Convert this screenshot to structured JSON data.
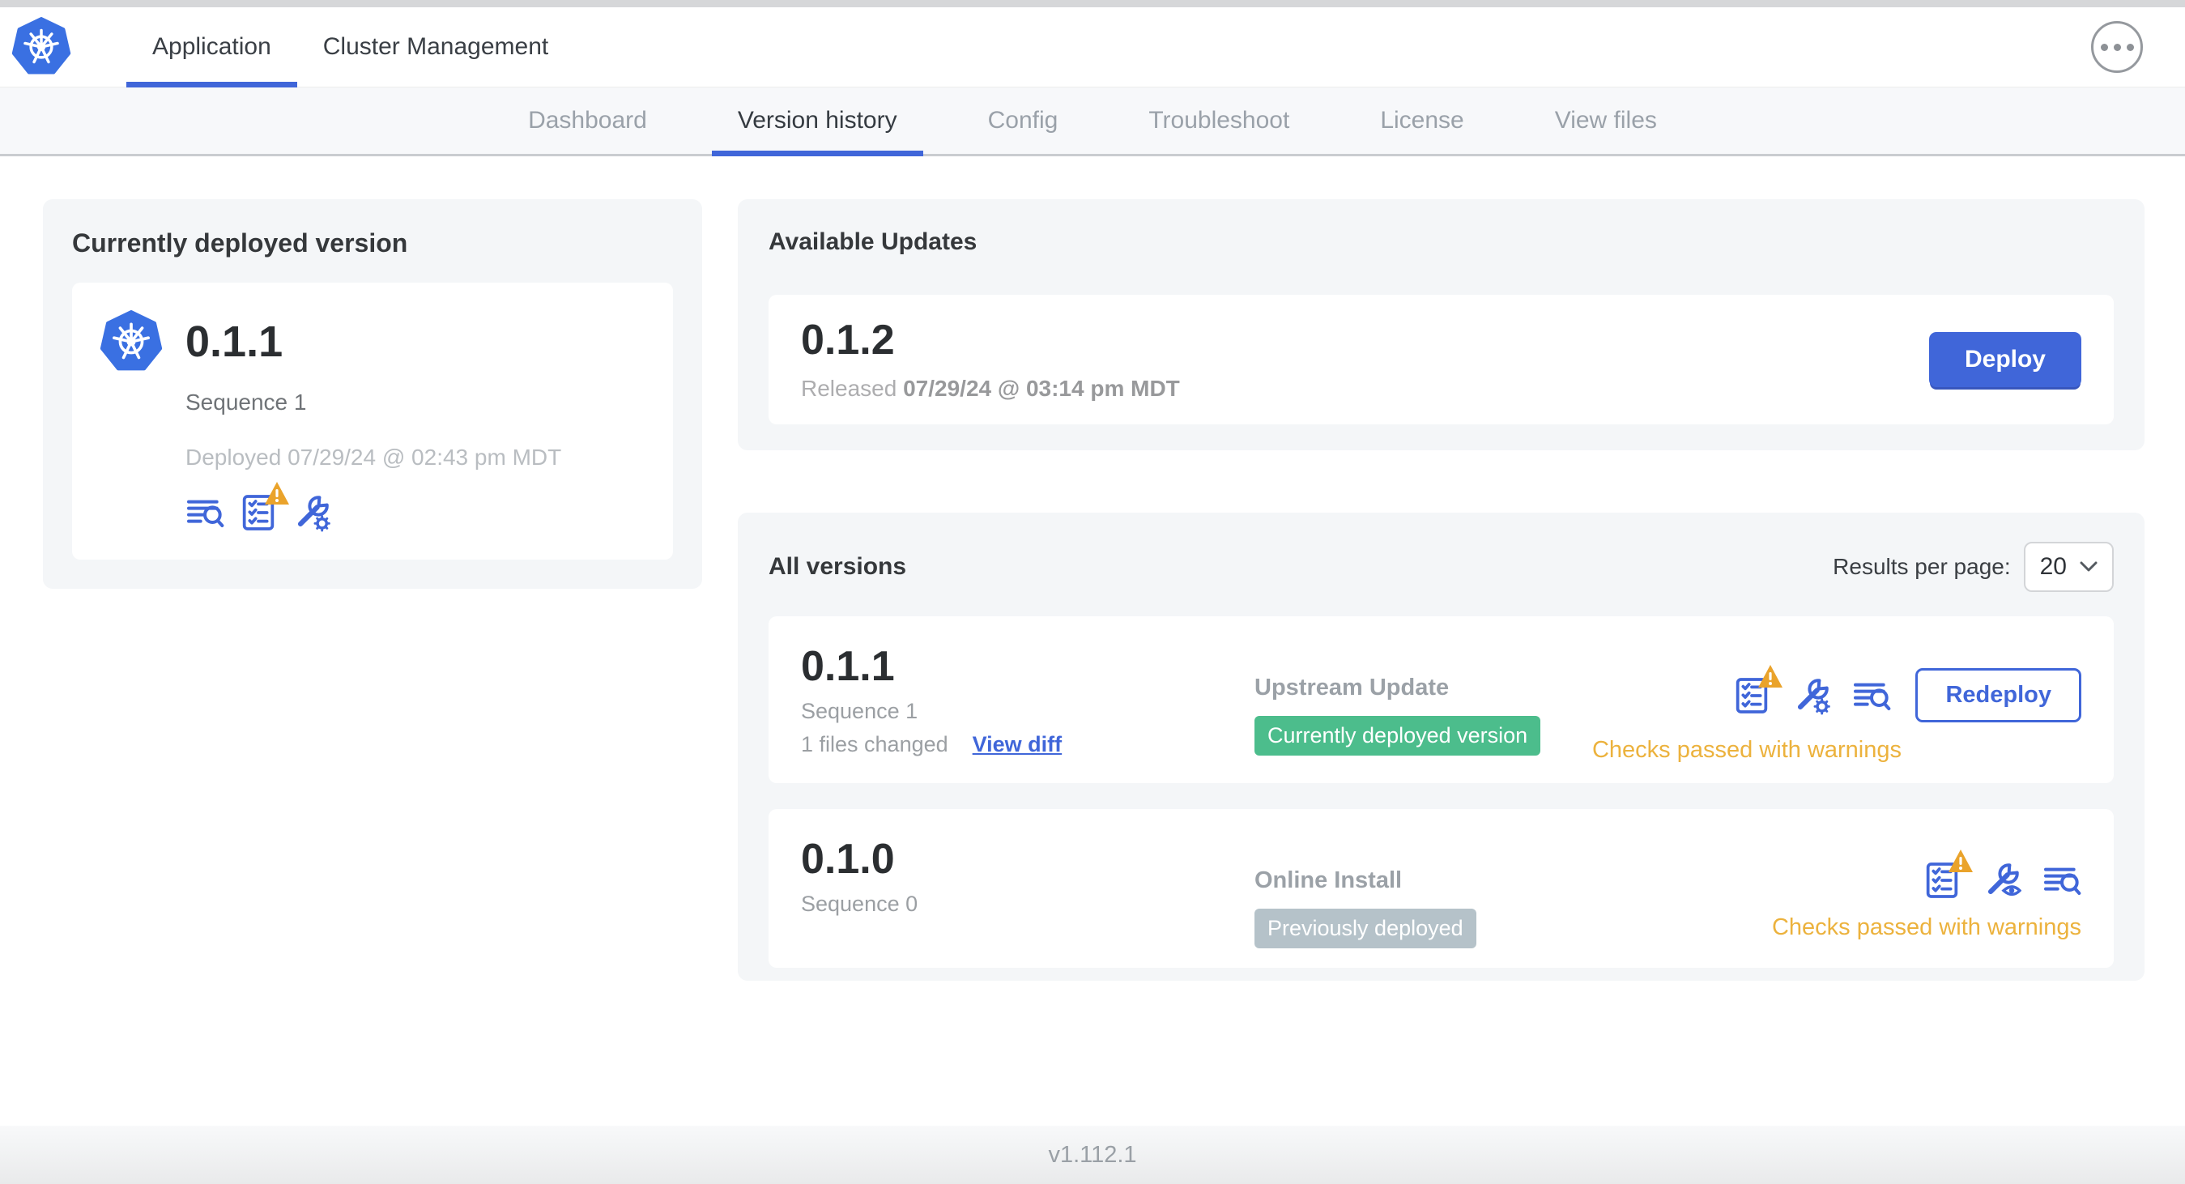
{
  "header": {
    "tabs": [
      {
        "label": "Application",
        "active": true
      },
      {
        "label": "Cluster Management",
        "active": false
      }
    ]
  },
  "subnav": {
    "items": [
      {
        "label": "Dashboard",
        "active": false
      },
      {
        "label": "Version history",
        "active": true
      },
      {
        "label": "Config",
        "active": false
      },
      {
        "label": "Troubleshoot",
        "active": false
      },
      {
        "label": "License",
        "active": false
      },
      {
        "label": "View files",
        "active": false
      }
    ]
  },
  "current_version_card": {
    "title": "Currently deployed version",
    "version": "0.1.1",
    "sequence": "Sequence 1",
    "deployed": "Deployed 07/29/24 @ 02:43 pm MDT",
    "icons": [
      "deploy-logs",
      "preflight-checks-warning",
      "config-tools"
    ]
  },
  "available_updates": {
    "title": "Available Updates",
    "version": "0.1.2",
    "released_label": "Released",
    "released_date": "07/29/24 @ 03:14 pm MDT",
    "deploy_label": "Deploy"
  },
  "all_versions": {
    "title": "All versions",
    "results_per_page_label": "Results per page:",
    "results_per_page_value": "20",
    "rows": [
      {
        "version": "0.1.1",
        "sequence": "Sequence 1",
        "files_changed": "1 files changed",
        "view_diff_label": "View diff",
        "source": "Upstream Update",
        "badge": "Currently deployed version",
        "badge_style": "green",
        "action_label": "Redeploy",
        "status": "Checks passed with warnings",
        "icons": [
          "preflight-checks-warning",
          "config-tools",
          "deploy-logs"
        ]
      },
      {
        "version": "0.1.0",
        "sequence": "Sequence 0",
        "source": "Online Install",
        "badge": "Previously deployed",
        "badge_style": "gray",
        "status": "Checks passed with warnings",
        "icons": [
          "preflight-checks-warning",
          "config-view",
          "deploy-logs"
        ]
      }
    ]
  },
  "footer": {
    "app_version": "v1.112.1"
  },
  "colors": {
    "accent": "#4066d9",
    "green": "#4cbd8c",
    "gray-badge": "#b5c2c9",
    "warning": "#ecb23d",
    "k8s-blue": "#3a70e2"
  }
}
